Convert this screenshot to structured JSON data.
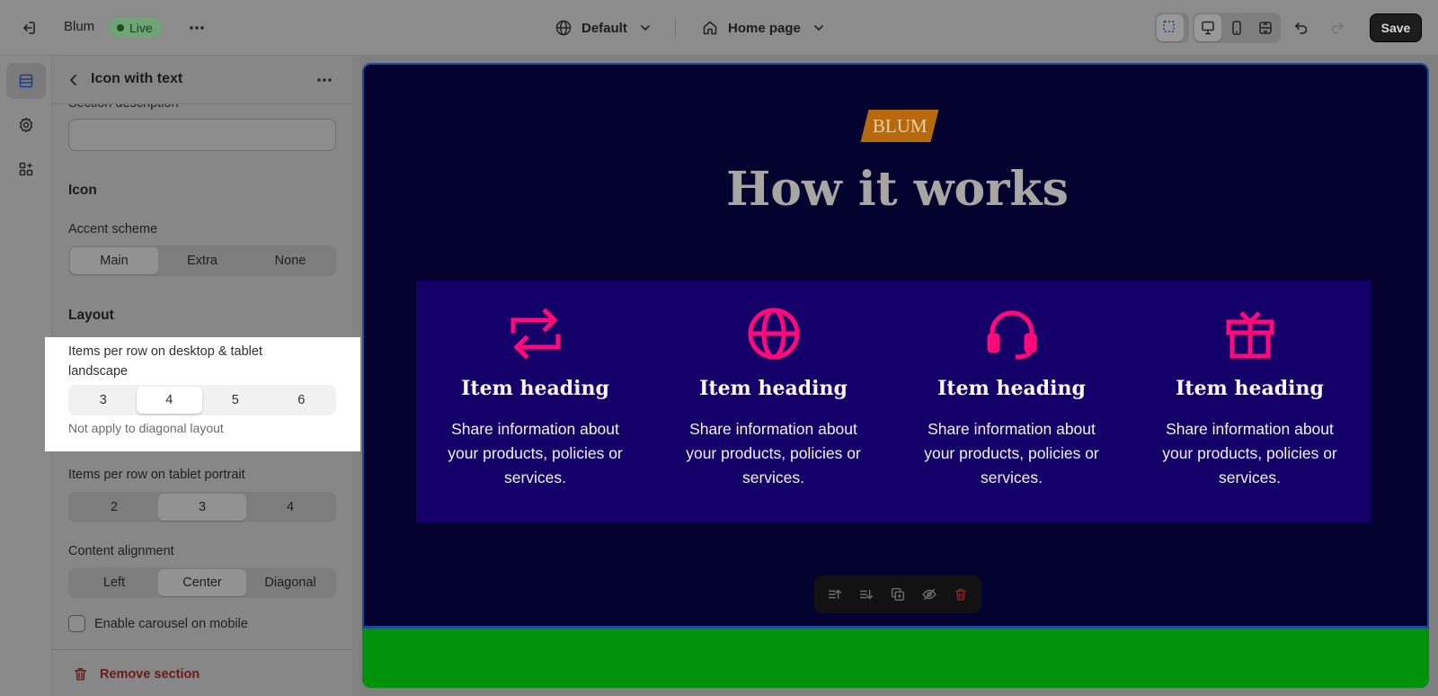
{
  "topbar": {
    "store_name": "Blum",
    "status_badge": "Live",
    "theme_select": "Default",
    "page_select": "Home page",
    "save_label": "Save"
  },
  "panel": {
    "title": "Icon with text",
    "section_description_label": "Section description",
    "icon_heading": "Icon",
    "accent_scheme_label": "Accent scheme",
    "accent_scheme_options": [
      "Main",
      "Extra",
      "None"
    ],
    "accent_scheme_selected": "Main",
    "layout_heading": "Layout",
    "items_per_row_desktop_label": "Items per row on desktop & tablet landscape",
    "items_per_row_desktop_options": [
      "3",
      "4",
      "5",
      "6"
    ],
    "items_per_row_desktop_selected": "4",
    "items_per_row_desktop_help": "Not apply to diagonal layout",
    "items_per_row_tablet_label": "Items per row on tablet portrait",
    "items_per_row_tablet_options": [
      "2",
      "3",
      "4"
    ],
    "items_per_row_tablet_selected": "3",
    "content_alignment_label": "Content alignment",
    "content_alignment_options": [
      "Left",
      "Center",
      "Diagonal"
    ],
    "content_alignment_selected": "Center",
    "carousel_label": "Enable carousel on mobile",
    "carousel_checked": false,
    "remove_section_label": "Remove section"
  },
  "preview": {
    "logo_text": "BLUM",
    "title": "How it works",
    "items": [
      {
        "icon": "exchange-arrows-icon",
        "heading": "Item heading",
        "text": "Share information about your products, policies or services."
      },
      {
        "icon": "globe-icon",
        "heading": "Item heading",
        "text": "Share information about your products, policies or services."
      },
      {
        "icon": "headset-icon",
        "heading": "Item heading",
        "text": "Share information about your products, policies or services."
      },
      {
        "icon": "gift-icon",
        "heading": "Item heading",
        "text": "Share information about your products, policies or services."
      }
    ]
  },
  "colors": {
    "accent_pink": "#ff0a78",
    "section_bg": "#040330",
    "items_bg": "#15006a",
    "footer_green": "#00920b",
    "logo_orange": "#b7690d"
  }
}
